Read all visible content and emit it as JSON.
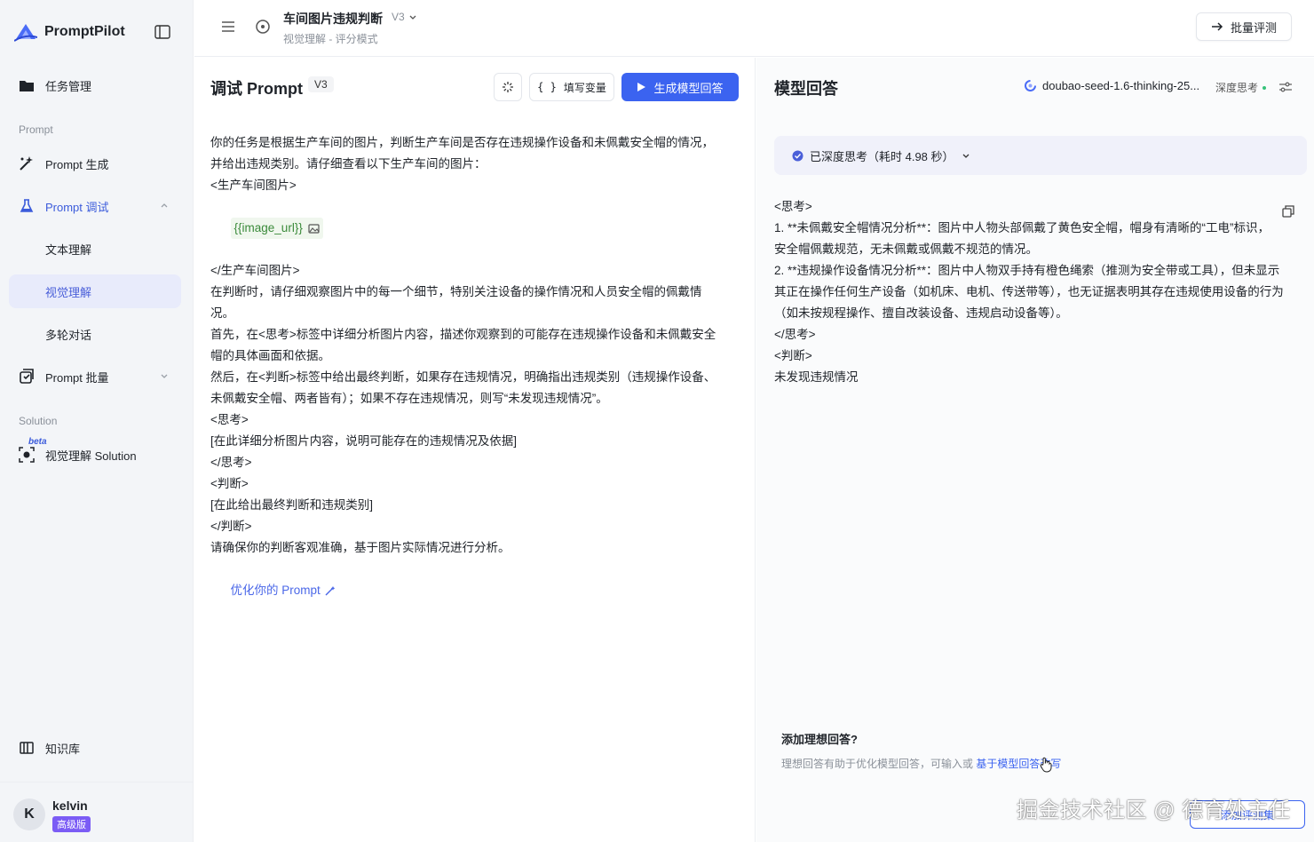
{
  "brand": {
    "name": "PromptPilot"
  },
  "sidebar": {
    "task_mgmt": "任务管理",
    "section_prompt": "Prompt",
    "prompt_gen": "Prompt 生成",
    "prompt_debug": "Prompt 调试",
    "sub_text": "文本理解",
    "sub_vision": "视觉理解",
    "sub_multiturn": "多轮对话",
    "prompt_batch": "Prompt 批量",
    "section_solution": "Solution",
    "beta": "beta",
    "vision_solution": "视觉理解 Solution",
    "knowledge": "知识库"
  },
  "user": {
    "initial": "K",
    "name": "kelvin",
    "badge": "高级版"
  },
  "header": {
    "title": "车间图片违规判断",
    "version": "V3",
    "subtitle": "视觉理解 - 评分模式",
    "batch_eval": "批量评测"
  },
  "left": {
    "title": "调试 Prompt",
    "version": "V3",
    "fill_vars": "填写变量",
    "generate": "生成模型回答",
    "lines": [
      "你的任务是根据生产车间的图片，判断生产车间是否存在违规操作设备和未佩戴安全帽的情况，",
      "并给出违规类别。请仔细查看以下生产车间的图片：",
      "<生产车间图片>",
      "{{image_url}}",
      "</生产车间图片>",
      "在判断时，请仔细观察图片中的每一个细节，特别关注设备的操作情况和人员安全帽的佩戴情",
      "况。",
      "首先，在<思考>标签中详细分析图片内容，描述你观察到的可能存在违规操作设备和未佩戴安全",
      "帽的具体画面和依据。",
      "然后，在<判断>标签中给出最终判断，如果存在违规情况，明确指出违规类别（违规操作设备、",
      "未佩戴安全帽、两者皆有）；如果不存在违规情况，则写“未发现违规情况”。",
      "<思考>",
      "[在此详细分析图片内容，说明可能存在的违规情况及依据]",
      "</思考>",
      "<判断>",
      "[在此给出最终判断和违规类别]",
      "</判断>",
      "请确保你的判断客观准确，基于图片实际情况进行分析。"
    ],
    "optimize": "优化你的 Prompt"
  },
  "right": {
    "title": "模型回答",
    "model": "doubao-seed-1.6-thinking-25...",
    "deep_think": "深度思考",
    "think_status": "已深度思考（耗时 4.98 秒）",
    "lines": [
      "<思考>",
      "1. **未佩戴安全帽情况分析**：图片中人物头部佩戴了黄色安全帽，帽身有清晰的“工电”标识，",
      "安全帽佩戴规范，无未佩戴或佩戴不规范的情况。",
      "2. **违规操作设备情况分析**：图片中人物双手持有橙色绳索（推测为安全带或工具），但未显示",
      "其正在操作任何生产设备（如机床、电机、传送带等），也无证据表明其存在违规使用设备的行为",
      "（如未按规程操作、擅自改装设备、违规启动设备等）。",
      "</思考>",
      "<判断>",
      "未发现违规情况"
    ],
    "ideal_title": "添加理想回答?",
    "ideal_desc": "理想回答有助于优化模型回答，可输入或 ",
    "ideal_link": "基于模型回答改写",
    "add_eval": "添加评测集"
  },
  "watermark": "掘金技术社区 @ 德育处主任",
  "colors": {
    "accent": "#3b63f0",
    "badge": "#7b5cf5",
    "var_green": "#3a8a3a"
  }
}
